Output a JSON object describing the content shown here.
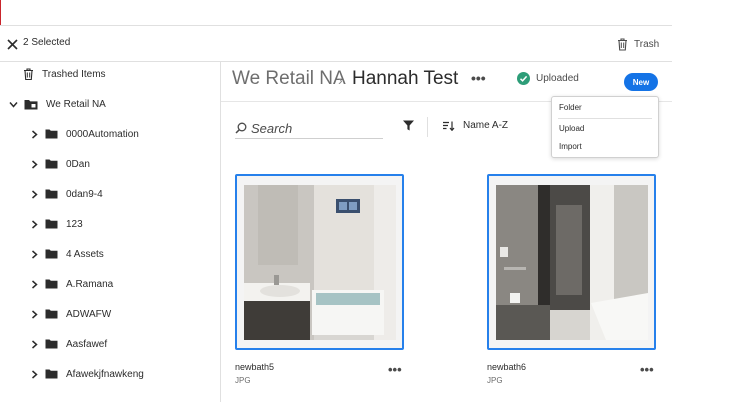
{
  "topbar": {
    "selection_label": "2 Selected",
    "trash_label": "Trash"
  },
  "sidebar": {
    "trashed_label": "Trashed Items",
    "root_label": "We Retail NA",
    "folders": [
      {
        "label": "0000Automation"
      },
      {
        "label": "0Dan"
      },
      {
        "label": "0dan9-4"
      },
      {
        "label": "123"
      },
      {
        "label": "4 Assets"
      },
      {
        "label": "A.Ramana"
      },
      {
        "label": "ADWAFW"
      },
      {
        "label": "Aasfawef"
      },
      {
        "label": "Afawekjfnawkeng"
      }
    ]
  },
  "header": {
    "breadcrumb_root": "We Retail NA",
    "breadcrumb_sep": "›",
    "breadcrumb_current": "Hannah Test",
    "more_label": "•••",
    "status_label": "Uploaded",
    "new_label": "New"
  },
  "toolbar": {
    "search_placeholder": "Search",
    "sort_label": "Name A-Z"
  },
  "menu": {
    "items": [
      "Folder",
      "Upload",
      "Import"
    ]
  },
  "assets": [
    {
      "name": "newbath5",
      "type": "JPG"
    },
    {
      "name": "newbath6",
      "type": "JPG"
    }
  ],
  "more_label": "•••",
  "colors": {
    "accent": "#1473e6",
    "selected_border": "#2680eb",
    "success": "#2d9d78",
    "folder": "#2c2c2c"
  }
}
